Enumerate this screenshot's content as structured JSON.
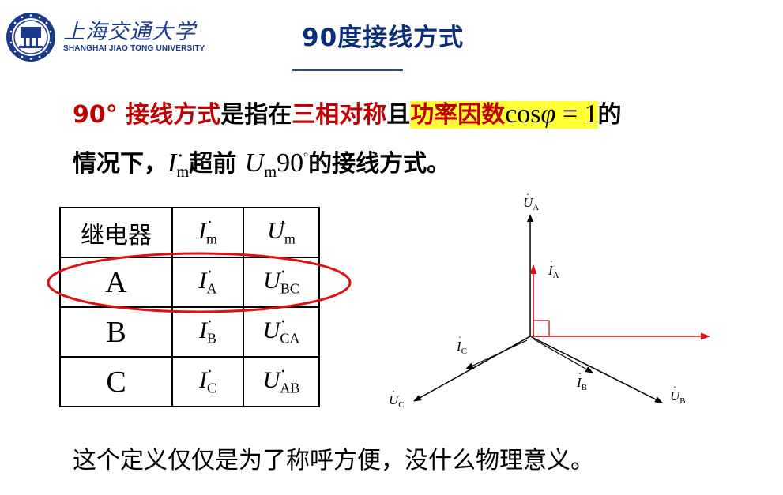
{
  "header": {
    "university_cn": "上海交通大学",
    "university_en": "SHANGHAI JIAO TONG UNIVERSITY",
    "title": "90度接线方式"
  },
  "definition": {
    "line1_prefix": "90°",
    "line1_term": "接线方式",
    "line1_mid": "是指在",
    "line1_symmetric": "三相对称",
    "line1_and": "且",
    "line1_pf": "功率因数",
    "line1_cos": "cos",
    "line1_phi": "φ",
    "line1_eq": " = 1",
    "line1_end": "的",
    "line2_prefix": "情况下，",
    "line2_I": "I",
    "line2_sub_m1": "m",
    "line2_lead": "超前",
    "line2_U": "U",
    "line2_sub_m2": "m",
    "line2_angle": "90",
    "line2_deg": "°",
    "line2_end": "的接线方式。"
  },
  "table": {
    "header": {
      "relay": "继电器",
      "i_sym": "I",
      "i_sub": "m",
      "u_sym": "U",
      "u_sub": "m"
    },
    "rows": [
      {
        "relay": "A",
        "i_sub": "A",
        "u_sub": "BC"
      },
      {
        "relay": "B",
        "i_sub": "B",
        "u_sub": "CA"
      },
      {
        "relay": "C",
        "i_sub": "C",
        "u_sub": "AB"
      }
    ]
  },
  "phasor": {
    "labels": {
      "ua": "U",
      "ua_sub": "A",
      "ub": "U",
      "ub_sub": "B",
      "uc": "U",
      "uc_sub": "C",
      "ia": "I",
      "ia_sub": "A",
      "ib": "I",
      "ib_sub": "B",
      "ic": "I",
      "ic_sub": "C"
    },
    "colors": {
      "voltage": "#000000",
      "current_a": "#c00000",
      "ref_axis": "#e01010",
      "right_angle": "#c00000"
    }
  },
  "footer": {
    "note": "这个定义仅仅是为了称呼方便，没什么物理意义。"
  },
  "colors": {
    "accent_red": "#c00000",
    "highlight": "#ffff33",
    "title_blue": "#0b2e7a",
    "ellipse": "#e01010"
  }
}
